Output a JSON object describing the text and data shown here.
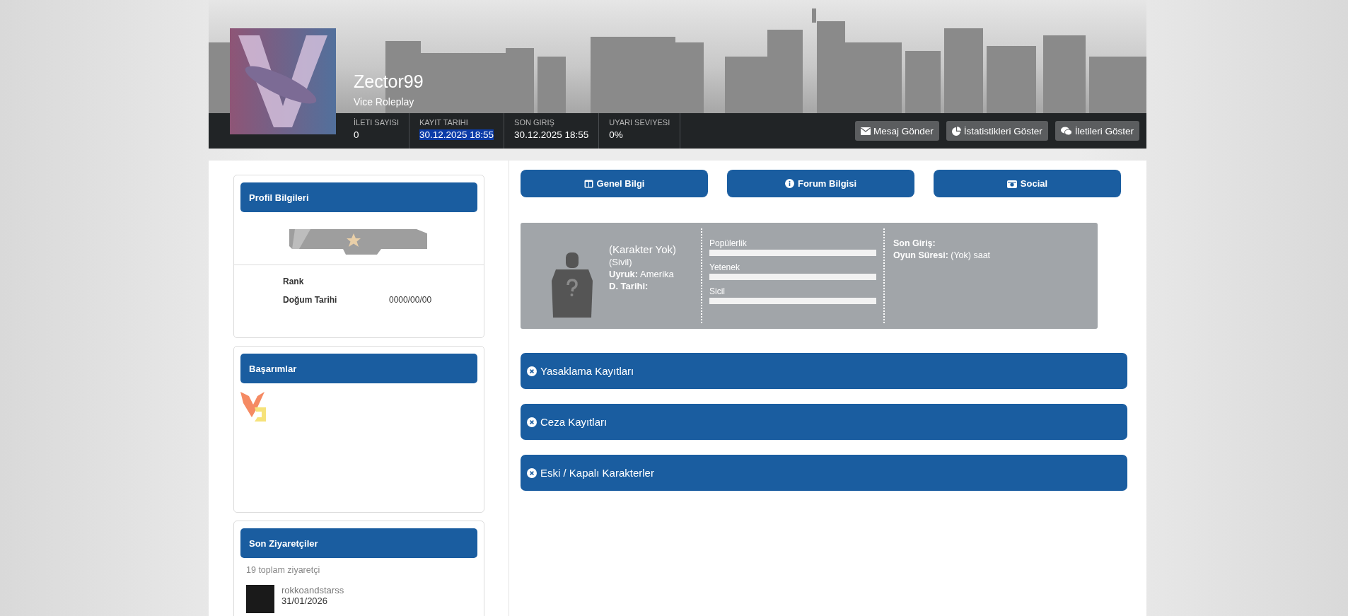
{
  "profile": {
    "username": "Zector99",
    "server": "Vice Roleplay"
  },
  "stats": [
    {
      "label": "İLETI SAYISI",
      "value": "0",
      "highlighted": false
    },
    {
      "label": "KAYIT TARIHI",
      "value": "30.12.2025 18:55",
      "highlighted": true
    },
    {
      "label": "SON GIRIŞ",
      "value": "30.12.2025 18:55",
      "highlighted": false
    },
    {
      "label": "UYARI SEVIYESI",
      "value": "0%",
      "highlighted": false
    }
  ],
  "actions": [
    "Mesaj Gönder",
    "İstatistikleri Göster",
    "İletileri Göster"
  ],
  "profile_card": {
    "title": "Profil Bilgileri",
    "fields": [
      {
        "label": "Rank"
      },
      {
        "label": "Doğum Tarihi",
        "value": "0000/00/00"
      }
    ]
  },
  "achievements": {
    "title": "Başarımlar"
  },
  "visitors": {
    "title": "Son Ziyaretçiler",
    "total": "19 toplam ziyaretçi",
    "items": [
      {
        "name": "rokkoandstarss",
        "date": "31/01/2026"
      }
    ]
  },
  "section_buttons": [
    "Genel Bilgi",
    "Forum Bilgisi",
    "Social"
  ],
  "character": {
    "name": "(Karakter Yok)",
    "faction": "(Sivil)",
    "details": [
      "**Uyruk:** Amerika",
      "**D. Tarihi:**"
    ],
    "meters": [
      {
        "label": "Popülerlik",
        "level": 0
      },
      {
        "label": "Yetenek",
        "level": 0
      },
      {
        "label": "Sicil",
        "level": 0
      }
    ],
    "info": [
      "**Son Giriş:**",
      "**Oyun Süresi:** (Yok) saat"
    ]
  },
  "records": [
    "Yasaklama Kayıtları",
    "Ceza Kayıtları",
    "Eski / Kapalı Karakterler"
  ]
}
